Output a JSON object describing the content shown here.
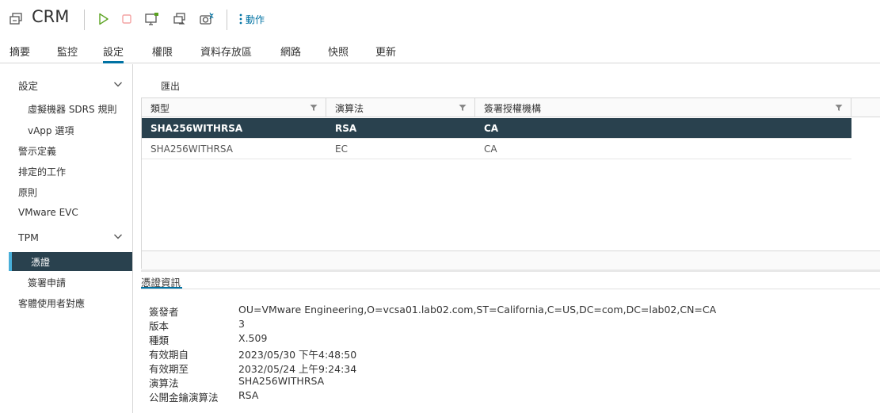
{
  "header": {
    "title": "CRM",
    "actions_label": "動作",
    "colors": {
      "play": "#5aa220",
      "stop": "#f4a3a3",
      "icon": "#555555",
      "accent": "#0072a3"
    }
  },
  "tabs": [
    "摘要",
    "監控",
    "設定",
    "權限",
    "資料存放區",
    "網路",
    "快照",
    "更新"
  ],
  "active_tab": "設定",
  "sidebar": {
    "group_settings": "設定",
    "sdrs_rules": "虛擬機器 SDRS 規則",
    "vapp_options": "vApp 選項",
    "alarm_definitions": "警示定義",
    "scheduled_tasks": "排定的工作",
    "policies": "原則",
    "vmware_evc": "VMware EVC",
    "group_tpm": "TPM",
    "certificates": "憑證",
    "signing_requests": "簽署申請",
    "guest_user_mappings": "客體使用者對應"
  },
  "toolbar": {
    "export_label": "匯出"
  },
  "table": {
    "columns": [
      "類型",
      "演算法",
      "簽署授權機構"
    ],
    "rows": [
      [
        "SHA256WITHRSA",
        "RSA",
        "CA"
      ],
      [
        "SHA256WITHRSA",
        "EC",
        "CA"
      ]
    ],
    "selected_row": 0
  },
  "details": {
    "title": "憑證資訊",
    "fields": [
      {
        "label": "簽發者",
        "value": "OU=VMware Engineering,O=vcsa01.lab02.com,ST=California,C=US,DC=com,DC=lab02,CN=CA"
      },
      {
        "label": "版本",
        "value": "3"
      },
      {
        "label": "種類",
        "value": "X.509"
      },
      {
        "label": "有效期自",
        "value": "2023/05/30 下午4:48:50"
      },
      {
        "label": "有效期至",
        "value": "2032/05/24 上午9:24:34"
      },
      {
        "label": "演算法",
        "value": "SHA256WITHRSA"
      },
      {
        "label": "公開金鑰演算法",
        "value": "RSA"
      }
    ]
  }
}
